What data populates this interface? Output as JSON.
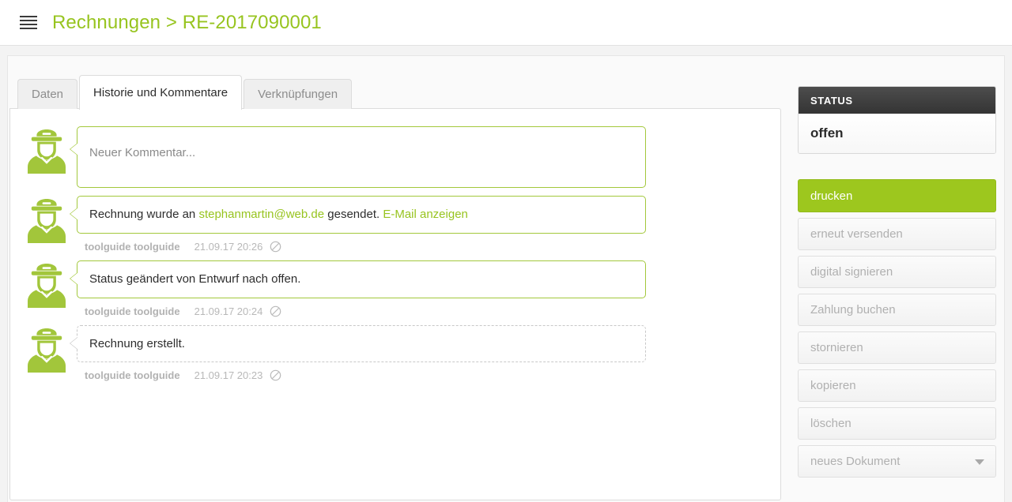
{
  "topbar": {
    "menu_icon": "hamburger-menu-icon",
    "breadcrumb": "Rechnungen > RE-2017090001"
  },
  "accent_color": "#97c41f",
  "tabs": [
    {
      "label": "Daten",
      "active": false
    },
    {
      "label": "Historie und Kommentare",
      "active": true
    },
    {
      "label": "Verknüpfungen",
      "active": false
    }
  ],
  "feed": {
    "composer": {
      "placeholder": "Neuer Kommentar...",
      "avatar_icon": "user-officer-avatar-icon"
    },
    "entries": [
      {
        "avatar_icon": "user-officer-avatar-icon",
        "text_before": "Rechnung wurde an ",
        "link_text": "stephanmartin@web.de",
        "text_after": " gesendet. ",
        "action_link": "E-Mail anzeigen",
        "author": "toolguide toolguide",
        "timestamp": "21.09.17 20:26",
        "status_icon": "circle-slash-icon",
        "style": "solid"
      },
      {
        "avatar_icon": "user-officer-avatar-icon",
        "text_before": "Status geändert von Entwurf nach offen.",
        "link_text": "",
        "text_after": "",
        "action_link": "",
        "author": "toolguide toolguide",
        "timestamp": "21.09.17 20:24",
        "status_icon": "circle-slash-icon",
        "style": "solid"
      },
      {
        "avatar_icon": "user-officer-avatar-icon",
        "text_before": "Rechnung erstellt.",
        "link_text": "",
        "text_after": "",
        "action_link": "",
        "author": "toolguide toolguide",
        "timestamp": "21.09.17 20:23",
        "status_icon": "circle-slash-icon",
        "style": "dashed"
      }
    ]
  },
  "sidebar": {
    "status_panel": {
      "header": "STATUS",
      "value": "offen"
    },
    "actions": [
      {
        "label": "drucken",
        "variant": "primary",
        "dropdown": false
      },
      {
        "label": "erneut versenden",
        "variant": "ghost",
        "dropdown": false
      },
      {
        "label": "digital signieren",
        "variant": "ghost",
        "dropdown": false
      },
      {
        "label": "Zahlung buchen",
        "variant": "ghost",
        "dropdown": false
      },
      {
        "label": "stornieren",
        "variant": "ghost",
        "dropdown": false
      },
      {
        "label": "kopieren",
        "variant": "ghost",
        "dropdown": false
      },
      {
        "label": "löschen",
        "variant": "ghost",
        "dropdown": false
      },
      {
        "label": "neues Dokument",
        "variant": "ghost",
        "dropdown": true
      }
    ]
  }
}
